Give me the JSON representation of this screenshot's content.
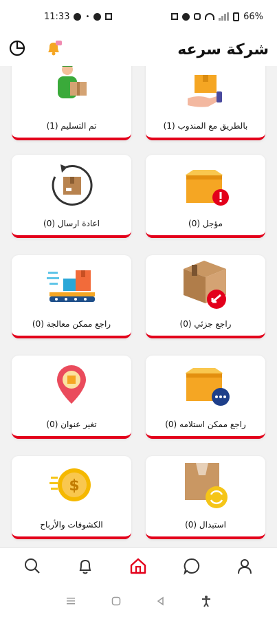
{
  "status_bar": {
    "time": "11:33",
    "battery": "66%"
  },
  "header": {
    "title": "شركة سرعه"
  },
  "cards": [
    {
      "label": "بالطريق مع المندوب (1)",
      "icon": "delivery-hand-box-icon"
    },
    {
      "label": "تم التسليم (1)",
      "icon": "delivery-man-box-icon"
    },
    {
      "label": "مؤجل (0)",
      "icon": "postponed-box-icon"
    },
    {
      "label": "اعادة ارسال (0)",
      "icon": "resend-box-icon"
    },
    {
      "label": "راجع جزئي (0)",
      "icon": "partial-return-box-icon"
    },
    {
      "label": "راجع ممكن معالجة (0)",
      "icon": "conveyor-boxes-icon"
    },
    {
      "label": "راجع ممكن استلامه (0)",
      "icon": "return-pending-box-icon"
    },
    {
      "label": "تغير عنوان (0)",
      "icon": "location-pin-icon"
    },
    {
      "label": "استبدال (0)",
      "icon": "exchange-box-icon"
    },
    {
      "label": "الكشوفات والأرباح",
      "icon": "dollar-coin-icon"
    }
  ],
  "bottom_nav": [
    "search-icon",
    "bell-icon",
    "home-icon",
    "chat-icon",
    "profile-icon"
  ],
  "colors": {
    "accent": "#e3001b",
    "box": "#f5a623",
    "card": "#ffffff",
    "bg": "#f2f2f2"
  }
}
